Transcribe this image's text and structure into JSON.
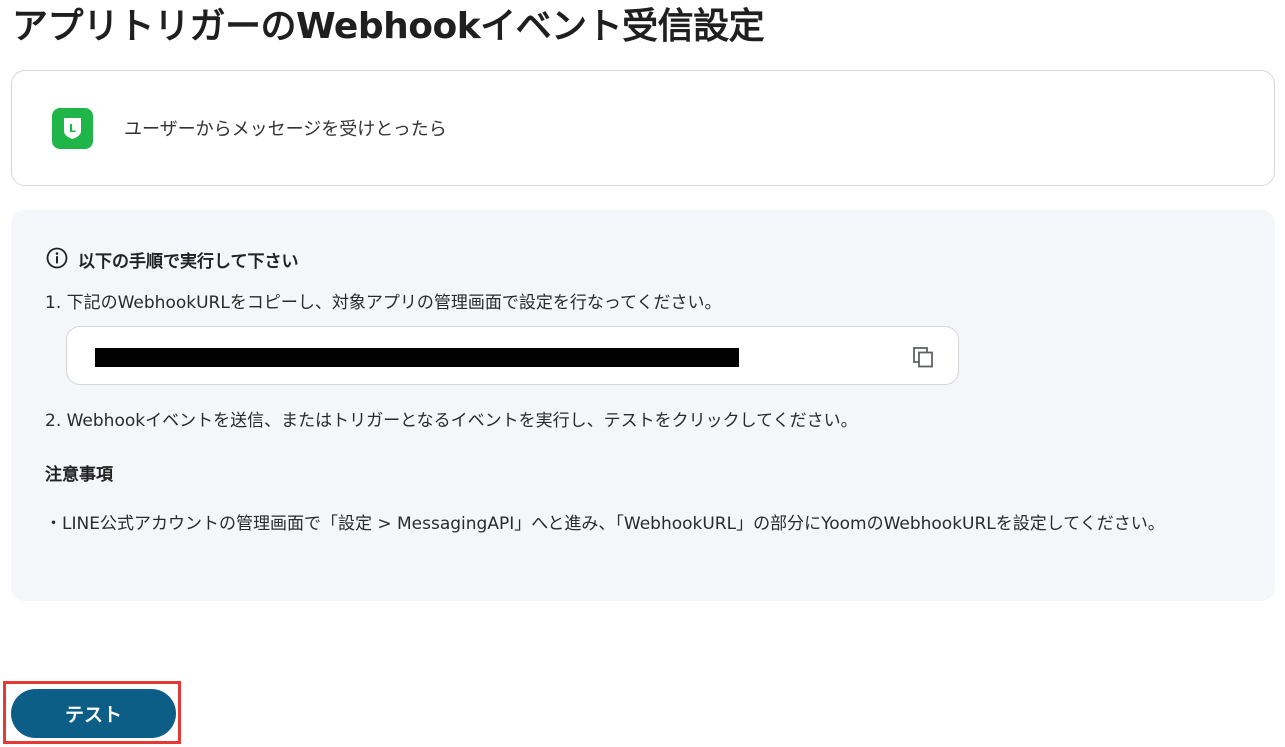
{
  "page": {
    "title": "アプリトリガーのWebhookイベント受信設定"
  },
  "trigger": {
    "app_icon": "line-app-icon",
    "app_icon_letter": "L",
    "label": "ユーザーからメッセージを受けとったら"
  },
  "instructions": {
    "heading": "以下の手順で実行して下さい",
    "step1": "1. 下記のWebhookURLをコピーし、対象アプリの管理画面で設定を行なってください。",
    "webhook_url": "",
    "step2": "2. Webhookイベントを送信、またはトリガーとなるイベントを実行し、テストをクリックしてください。",
    "caution_heading": "注意事項",
    "caution_note": "・LINE公式アカウントの管理画面で「設定 > MessagingAPI」へと進み、「WebhookURL」の部分にYoomのWebhookURLを設定してください。"
  },
  "actions": {
    "test_label": "テスト"
  },
  "colors": {
    "line_green": "#1fb548",
    "button_blue": "#0d5e87",
    "highlight_red": "#e53935",
    "panel_bg": "#f4f6f9"
  }
}
